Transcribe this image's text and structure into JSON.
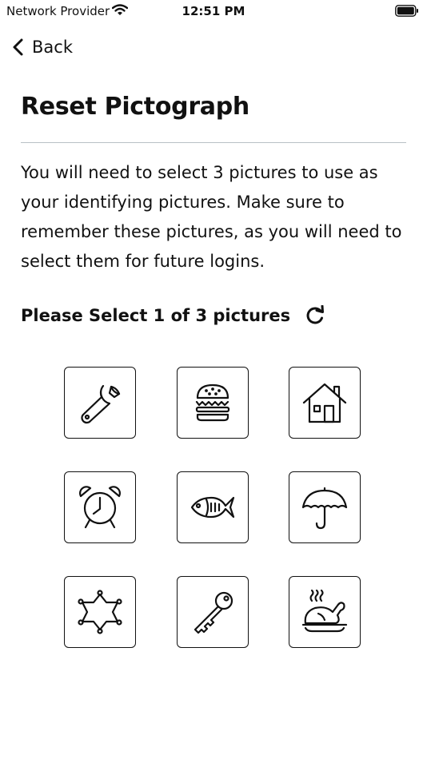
{
  "status_bar": {
    "carrier": "Network Provider",
    "time": "12:51 PM"
  },
  "nav": {
    "back_label": "Back"
  },
  "title": "Reset Pictograph",
  "description": "You will need to select 3 pictures to use as your identifying pictures. Make sure to remember these pictures, as you will need to select them for future logins.",
  "selection": {
    "label": "Please Select 1 of 3 pictures"
  },
  "pictures": [
    {
      "icon": "wrench-icon"
    },
    {
      "icon": "burger-icon"
    },
    {
      "icon": "house-icon"
    },
    {
      "icon": "alarm-clock-icon"
    },
    {
      "icon": "fish-icon"
    },
    {
      "icon": "umbrella-icon"
    },
    {
      "icon": "sheriff-star-icon"
    },
    {
      "icon": "key-icon"
    },
    {
      "icon": "roast-chicken-icon"
    }
  ]
}
